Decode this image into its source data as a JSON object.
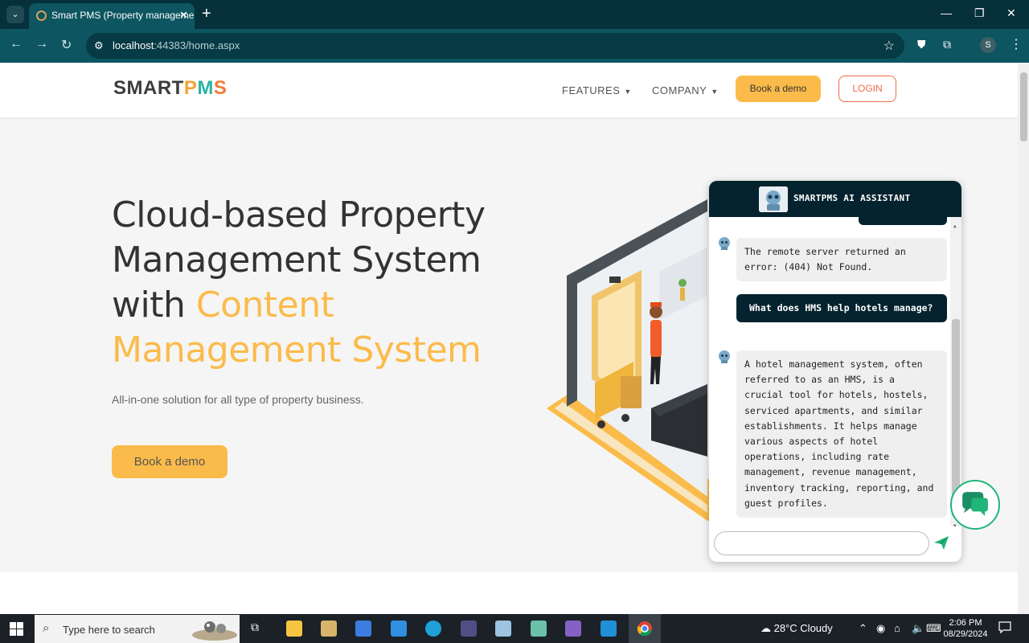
{
  "browser": {
    "tab_title": "Smart PMS (Property manageme",
    "tab_close": "✕",
    "new_tab": "+",
    "url_host": "localhost",
    "url_rest": ":44383/home.aspx",
    "profile_initial": "S"
  },
  "nav": {
    "logo_smart": "SMART",
    "logo_p": "P",
    "logo_m": "M",
    "logo_s": "S",
    "features": "FEATURES",
    "company": "COMPANY",
    "book_demo": "Book a demo",
    "login": "LOGIN"
  },
  "hero": {
    "title_line1": "Cloud-based Property",
    "title_line2": "Management System",
    "title_with": "with ",
    "title_accent1": "Content",
    "title_accent2": "Management System",
    "subtitle": "All-in-one solution for all type of property business.",
    "cta": "Book a demo"
  },
  "chat": {
    "title": "SMARTPMS AI ASSISTANT",
    "messages": [
      {
        "role": "bot",
        "text": "The remote server returned an error: (404) Not Found."
      },
      {
        "role": "user",
        "text": "What does HMS help hotels manage?"
      },
      {
        "role": "bot",
        "text": "A hotel management system, often referred to as an HMS, is a crucial tool for hotels, hostels, serviced apartments, and similar establishments. It helps manage various aspects of hotel operations, including rate management, revenue management, inventory tracking, reporting, and guest profiles."
      }
    ],
    "input_placeholder": ""
  },
  "taskbar": {
    "search_placeholder": "Type here to search",
    "temperature": "28°C",
    "weather": "Cloudy",
    "time": "2:06 PM",
    "date": "08/29/2024"
  },
  "colors": {
    "chrome_dark": "#06303a",
    "chrome_tab": "#0d5560",
    "accent_yellow": "#fbbb4a",
    "login_red": "#ef6b4a",
    "chat_navy": "#05232e",
    "chat_green": "#21b57a"
  }
}
